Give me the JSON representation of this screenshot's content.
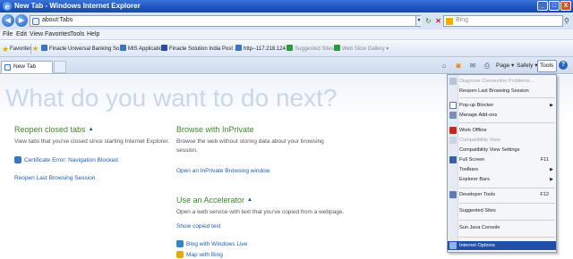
{
  "window": {
    "title": "New Tab - Windows Internet Explorer",
    "min": "_",
    "max": "□",
    "close": "X"
  },
  "address": {
    "value": "about:Tabs",
    "search_placeholder": "Bing",
    "dropdown": "▼"
  },
  "menu": [
    "File",
    "Edit",
    "View",
    "Favorites",
    "Tools",
    "Help"
  ],
  "favorites_bar": {
    "label": "Favorites",
    "items": [
      "Finacle Universal Banking So...",
      "MIS Application",
      "Finacle Solution  India Post ...",
      "http--117.218.124",
      "Suggested Sites ▾",
      "Web Slice Gallery ▾"
    ]
  },
  "tab": {
    "label": "New Tab"
  },
  "commandbar": {
    "page": "Page ▾",
    "safety": "Safety ▾",
    "tools": "Tools ▾",
    "help": "?"
  },
  "content": {
    "headline": "What do you want to do next?",
    "reopen": {
      "title": "Reopen closed tabs",
      "desc": "View tabs that you've closed since starting Internet Explorer.",
      "link1": "Certificate Error: Navigation Blocked",
      "link2": "Reopen Last Browsing Session"
    },
    "inprivate": {
      "title": "Browse with InPrivate",
      "desc": "Browse the web without storing data about your browsing session.",
      "link": "Open an InPrivate Browsing window"
    },
    "accelerator": {
      "title": "Use an Accelerator",
      "desc": "Open a web service with text that you've copied from a webpage.",
      "link1": "Show copied text",
      "link2": "Blog with Windows Live",
      "link3": "Map with Bing"
    }
  },
  "tools_menu": {
    "items": [
      {
        "label": "Diagnose Connection Problems...",
        "disabled": true
      },
      {
        "label": "Reopen Last Browsing Session"
      },
      {
        "label": "Pop-up Blocker"
      },
      {
        "label": "Manage Add-ons"
      },
      {
        "label": "Work Offline"
      },
      {
        "label": "Compatibility View",
        "disabled": true
      },
      {
        "label": "Compatibility View Settings"
      },
      {
        "label": "Full Screen",
        "shortcut": "F11"
      },
      {
        "label": "Toolbars"
      },
      {
        "label": "Explorer Bars"
      },
      {
        "label": "Developer Tools",
        "shortcut": "F12"
      },
      {
        "label": "Suggested Sites"
      },
      {
        "label": "Sun Java Console"
      },
      {
        "label": "Internet Options"
      }
    ]
  },
  "colors": {
    "titlebar": "#1e56c2",
    "accent_green": "#3a8a2a",
    "link_blue": "#1e5fb7",
    "menu_highlight": "#1f4fa8"
  }
}
